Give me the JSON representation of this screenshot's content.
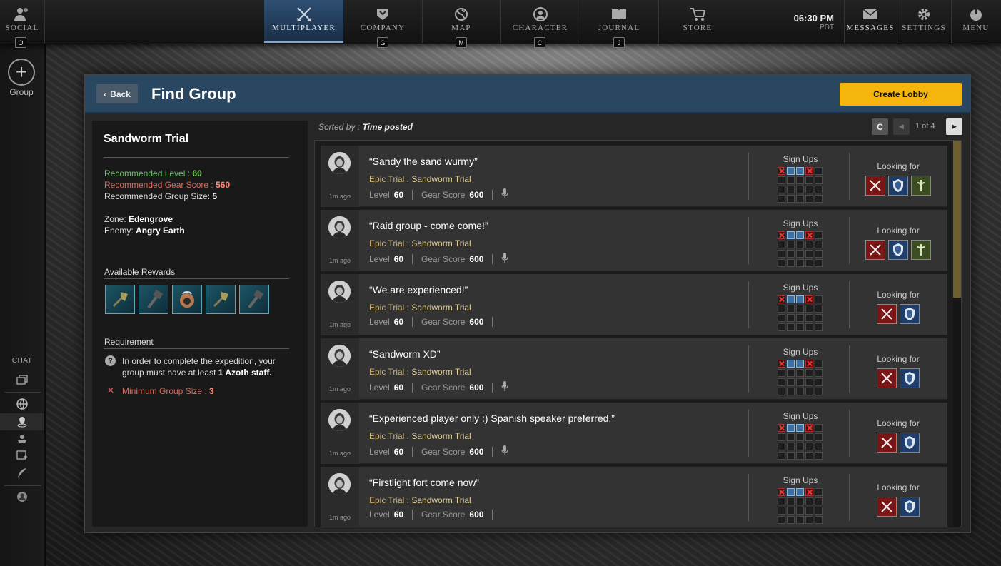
{
  "topbar": {
    "social": {
      "label": "SOCIAL",
      "key": "O"
    },
    "nav": [
      {
        "id": "multiplayer",
        "label": "MULTIPLAYER",
        "icon": "crossed-swords-icon",
        "key": ""
      },
      {
        "id": "company",
        "label": "COMPANY",
        "icon": "shield-chevron-icon",
        "key": "G"
      },
      {
        "id": "map",
        "label": "MAP",
        "icon": "globe-icon",
        "key": "M"
      },
      {
        "id": "character",
        "label": "CHARACTER",
        "icon": "person-icon",
        "key": "C"
      },
      {
        "id": "journal",
        "label": "JOURNAL",
        "icon": "book-icon",
        "key": "J"
      },
      {
        "id": "store",
        "label": "STORE",
        "icon": "cart-icon",
        "key": ""
      }
    ],
    "time": "06:30 PM",
    "timezone": "PDT",
    "messages": "MESSAGES",
    "settings": "SETTINGS",
    "menu": "MENU"
  },
  "leftrail": {
    "group_label": "Group",
    "chat_label": "CHAT"
  },
  "header": {
    "back": "Back",
    "title": "Find Group",
    "create": "Create Lobby"
  },
  "info": {
    "title": "Sandworm Trial",
    "rec_level_label": "Recommended Level :",
    "rec_level": "60",
    "rec_gear_label": "Recommended Gear Score :",
    "rec_gear": "560",
    "rec_size_label": "Recommended Group Size:",
    "rec_size": "5",
    "zone_label": "Zone:",
    "zone": "Edengrove",
    "enemy_label": "Enemy:",
    "enemy": "Angry Earth",
    "rewards_label": "Available Rewards",
    "rewards": [
      "axe-icon",
      "hammer-icon",
      "bag-icon",
      "axe-icon",
      "hammer-icon"
    ],
    "requirement_label": "Requirement",
    "requirement_text": "In order to complete the expedition, your group must have at least",
    "requirement_bold": "1 Azoth staff.",
    "min_size_label": "Minimum Group Size :",
    "min_size": "3"
  },
  "list": {
    "sorted_label": "Sorted by :",
    "sorted_value": "Time posted",
    "page": "1 of 4",
    "refresh": "C",
    "signups_label": "Sign Ups",
    "looking_label": "Looking for",
    "level_label": "Level",
    "gear_label": "Gear Score",
    "type_prefix": "Epic Trial :",
    "items": [
      {
        "title": "“Sandy the sand wurmy”",
        "ago": "1m ago",
        "type": "Sandworm Trial",
        "level": "60",
        "gear": "600",
        "mic": true,
        "roles": [
          "dps",
          "tank",
          "heal"
        ]
      },
      {
        "title": "“Raid group - come come!”",
        "ago": "1m ago",
        "type": "Sandworm Trial",
        "level": "60",
        "gear": "600",
        "mic": true,
        "roles": [
          "dps",
          "tank",
          "heal"
        ]
      },
      {
        "title": "“We are experienced!”",
        "ago": "1m ago",
        "type": "Sandworm Trial",
        "level": "60",
        "gear": "600",
        "mic": false,
        "roles": [
          "dps",
          "tank"
        ]
      },
      {
        "title": "“Sandworm XD”",
        "ago": "1m ago",
        "type": "Sandworm Trial",
        "level": "60",
        "gear": "600",
        "mic": true,
        "roles": [
          "dps",
          "tank"
        ]
      },
      {
        "title": "“Experienced player only :) Spanish speaker preferred.”",
        "ago": "1m ago",
        "type": "Sandworm Trial",
        "level": "60",
        "gear": "600",
        "mic": true,
        "roles": [
          "dps",
          "tank"
        ]
      },
      {
        "title": "“Firstlight fort come now”",
        "ago": "1m ago",
        "type": "Sandworm Trial",
        "level": "60",
        "gear": "600",
        "mic": false,
        "roles": [
          "dps",
          "tank"
        ]
      }
    ]
  },
  "colors": {
    "accent": "#f5b50d",
    "header": "#2a4762",
    "nav_active": "#2e4f73",
    "dps": "#7a1515",
    "tank": "#1e3d6b",
    "healer": "#3d4d22"
  }
}
